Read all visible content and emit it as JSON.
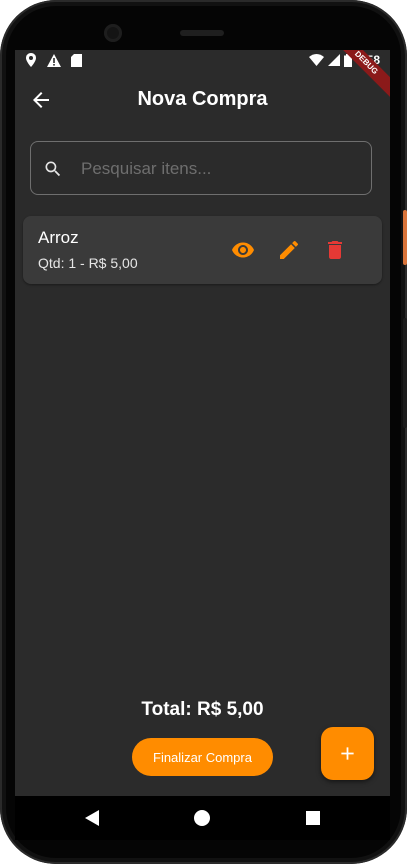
{
  "status_bar": {
    "time": "9:58",
    "left_icons": [
      "location-icon",
      "warning-icon",
      "sd-card-icon"
    ],
    "right_icons": [
      "wifi-icon",
      "signal-icon",
      "battery-icon"
    ],
    "debug_banner": "DEBUG"
  },
  "app_bar": {
    "title": "Nova Compra",
    "back_icon": "arrow-back-icon"
  },
  "search": {
    "placeholder": "Pesquisar itens...",
    "value": ""
  },
  "items": [
    {
      "name": "Arroz",
      "details": "Qtd: 1 - R$ 5,00",
      "actions": [
        "view-icon",
        "edit-icon",
        "delete-icon"
      ]
    }
  ],
  "footer": {
    "total": "Total: R$ 5,00",
    "finalize_label": "Finalizar Compra",
    "fab_icon": "plus-icon"
  },
  "colors": {
    "accent": "#FF8C00",
    "delete": "#E53935",
    "background": "#2B2B2B",
    "card": "#3A3A3A"
  }
}
